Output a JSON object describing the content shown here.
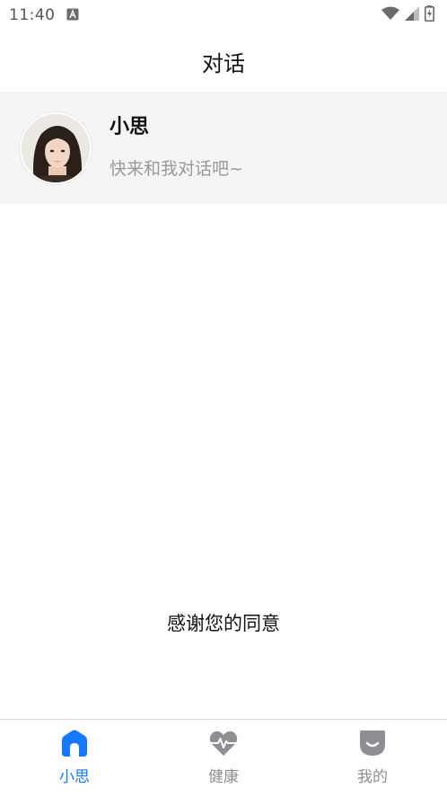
{
  "status_bar": {
    "time": "11:40",
    "icons": [
      "a-notification-icon",
      "wifi-icon",
      "signal-icon",
      "battery-charging-icon"
    ]
  },
  "header": {
    "title": "对话"
  },
  "conversation": {
    "name": "小思",
    "preview": "快来和我对话吧~",
    "avatar_icon": "avatar-photo"
  },
  "main": {
    "message": "感谢您的同意"
  },
  "bottom_nav": {
    "items": [
      {
        "label": "小思",
        "icon": "home-icon",
        "active": true
      },
      {
        "label": "健康",
        "icon": "heart-pulse-icon",
        "active": false
      },
      {
        "label": "我的",
        "icon": "smile-badge-icon",
        "active": false
      }
    ],
    "active_color": "#1677ff",
    "inactive_color": "#8e8e93"
  }
}
